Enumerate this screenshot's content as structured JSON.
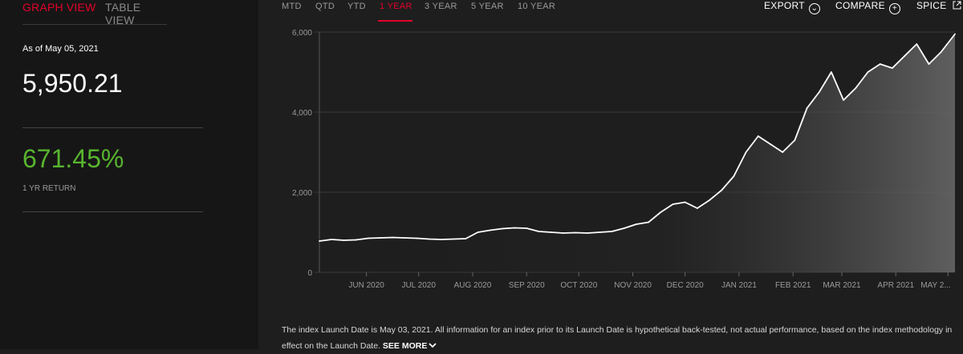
{
  "view_tabs": {
    "graph": "GRAPH VIEW",
    "table": "TABLE VIEW"
  },
  "summary": {
    "as_of": "As of May 05, 2021",
    "price": "5,950.21",
    "return_value": "671.45%",
    "return_label": "1 YR RETURN"
  },
  "range_tabs": [
    "MTD",
    "QTD",
    "YTD",
    "1 YEAR",
    "3 YEAR",
    "5 YEAR",
    "10 YEAR"
  ],
  "range_active": "1 YEAR",
  "actions": {
    "export": "EXPORT",
    "compare": "COMPARE",
    "spice": "SPICE"
  },
  "colors": {
    "accent": "#e4002b",
    "positive": "#58b52e",
    "background": "#1e1e1e",
    "panel": "#161616"
  },
  "disclaimer": {
    "text": "The index Launch Date is May 03, 2021.  All information for an index prior to its Launch Date is hypothetical back-tested, not actual performance, based on the index methodology in effect on the Launch Date.",
    "see_more": "SEE MORE"
  },
  "chart_data": {
    "type": "area",
    "series": [
      {
        "x": [
          "2020-05-05",
          "2020-05-12",
          "2020-05-19",
          "2020-05-26",
          "2020-06-02",
          "2020-06-09",
          "2020-06-16",
          "2020-06-23",
          "2020-06-30",
          "2020-07-07",
          "2020-07-14",
          "2020-07-21",
          "2020-07-28",
          "2020-08-04",
          "2020-08-11",
          "2020-08-18",
          "2020-08-25",
          "2020-09-01",
          "2020-09-08",
          "2020-09-15",
          "2020-09-22",
          "2020-09-29",
          "2020-10-06",
          "2020-10-13",
          "2020-10-20",
          "2020-10-27",
          "2020-11-03",
          "2020-11-10",
          "2020-11-17",
          "2020-11-24",
          "2020-12-01",
          "2020-12-08",
          "2020-12-15",
          "2020-12-22",
          "2020-12-29",
          "2021-01-05",
          "2021-01-12",
          "2021-01-19",
          "2021-01-26",
          "2021-02-02",
          "2021-02-09",
          "2021-02-16",
          "2021-02-23",
          "2021-03-02",
          "2021-03-09",
          "2021-03-16",
          "2021-03-23",
          "2021-03-30",
          "2021-04-06",
          "2021-04-13",
          "2021-04-20",
          "2021-04-27",
          "2021-05-05"
        ],
        "values": [
          780,
          820,
          800,
          810,
          850,
          860,
          870,
          860,
          850,
          830,
          820,
          830,
          840,
          1000,
          1050,
          1090,
          1110,
          1100,
          1020,
          1000,
          980,
          990,
          980,
          1000,
          1020,
          1100,
          1200,
          1250,
          1500,
          1700,
          1750,
          1600,
          1800,
          2050,
          2400,
          3000,
          3400,
          3200,
          3000,
          3300,
          4100,
          4500,
          5000,
          4300,
          4600,
          5000,
          5200,
          5100,
          5400,
          5700,
          5200,
          5500,
          5950
        ]
      }
    ],
    "ylim": [
      0,
      6000
    ],
    "y_ticks": [
      0,
      2000,
      4000,
      6000
    ],
    "y_tick_labels": [
      "0",
      "2,000",
      "4,000",
      "6,000"
    ],
    "x_tick_labels": [
      "JUN 2020",
      "JUL 2020",
      "AUG 2020",
      "SEP 2020",
      "OCT 2020",
      "NOV 2020",
      "DEC 2020",
      "JAN 2021",
      "FEB 2021",
      "MAR 2021",
      "APR 2021",
      "MAY 2..."
    ],
    "x_tick_dates": [
      "2020-06-01",
      "2020-07-01",
      "2020-08-01",
      "2020-09-01",
      "2020-10-01",
      "2020-11-01",
      "2020-12-01",
      "2021-01-01",
      "2021-02-01",
      "2021-03-01",
      "2021-04-01",
      "2021-05-01"
    ],
    "xlim": [
      "2020-05-05",
      "2021-05-05"
    ],
    "grid": true
  }
}
